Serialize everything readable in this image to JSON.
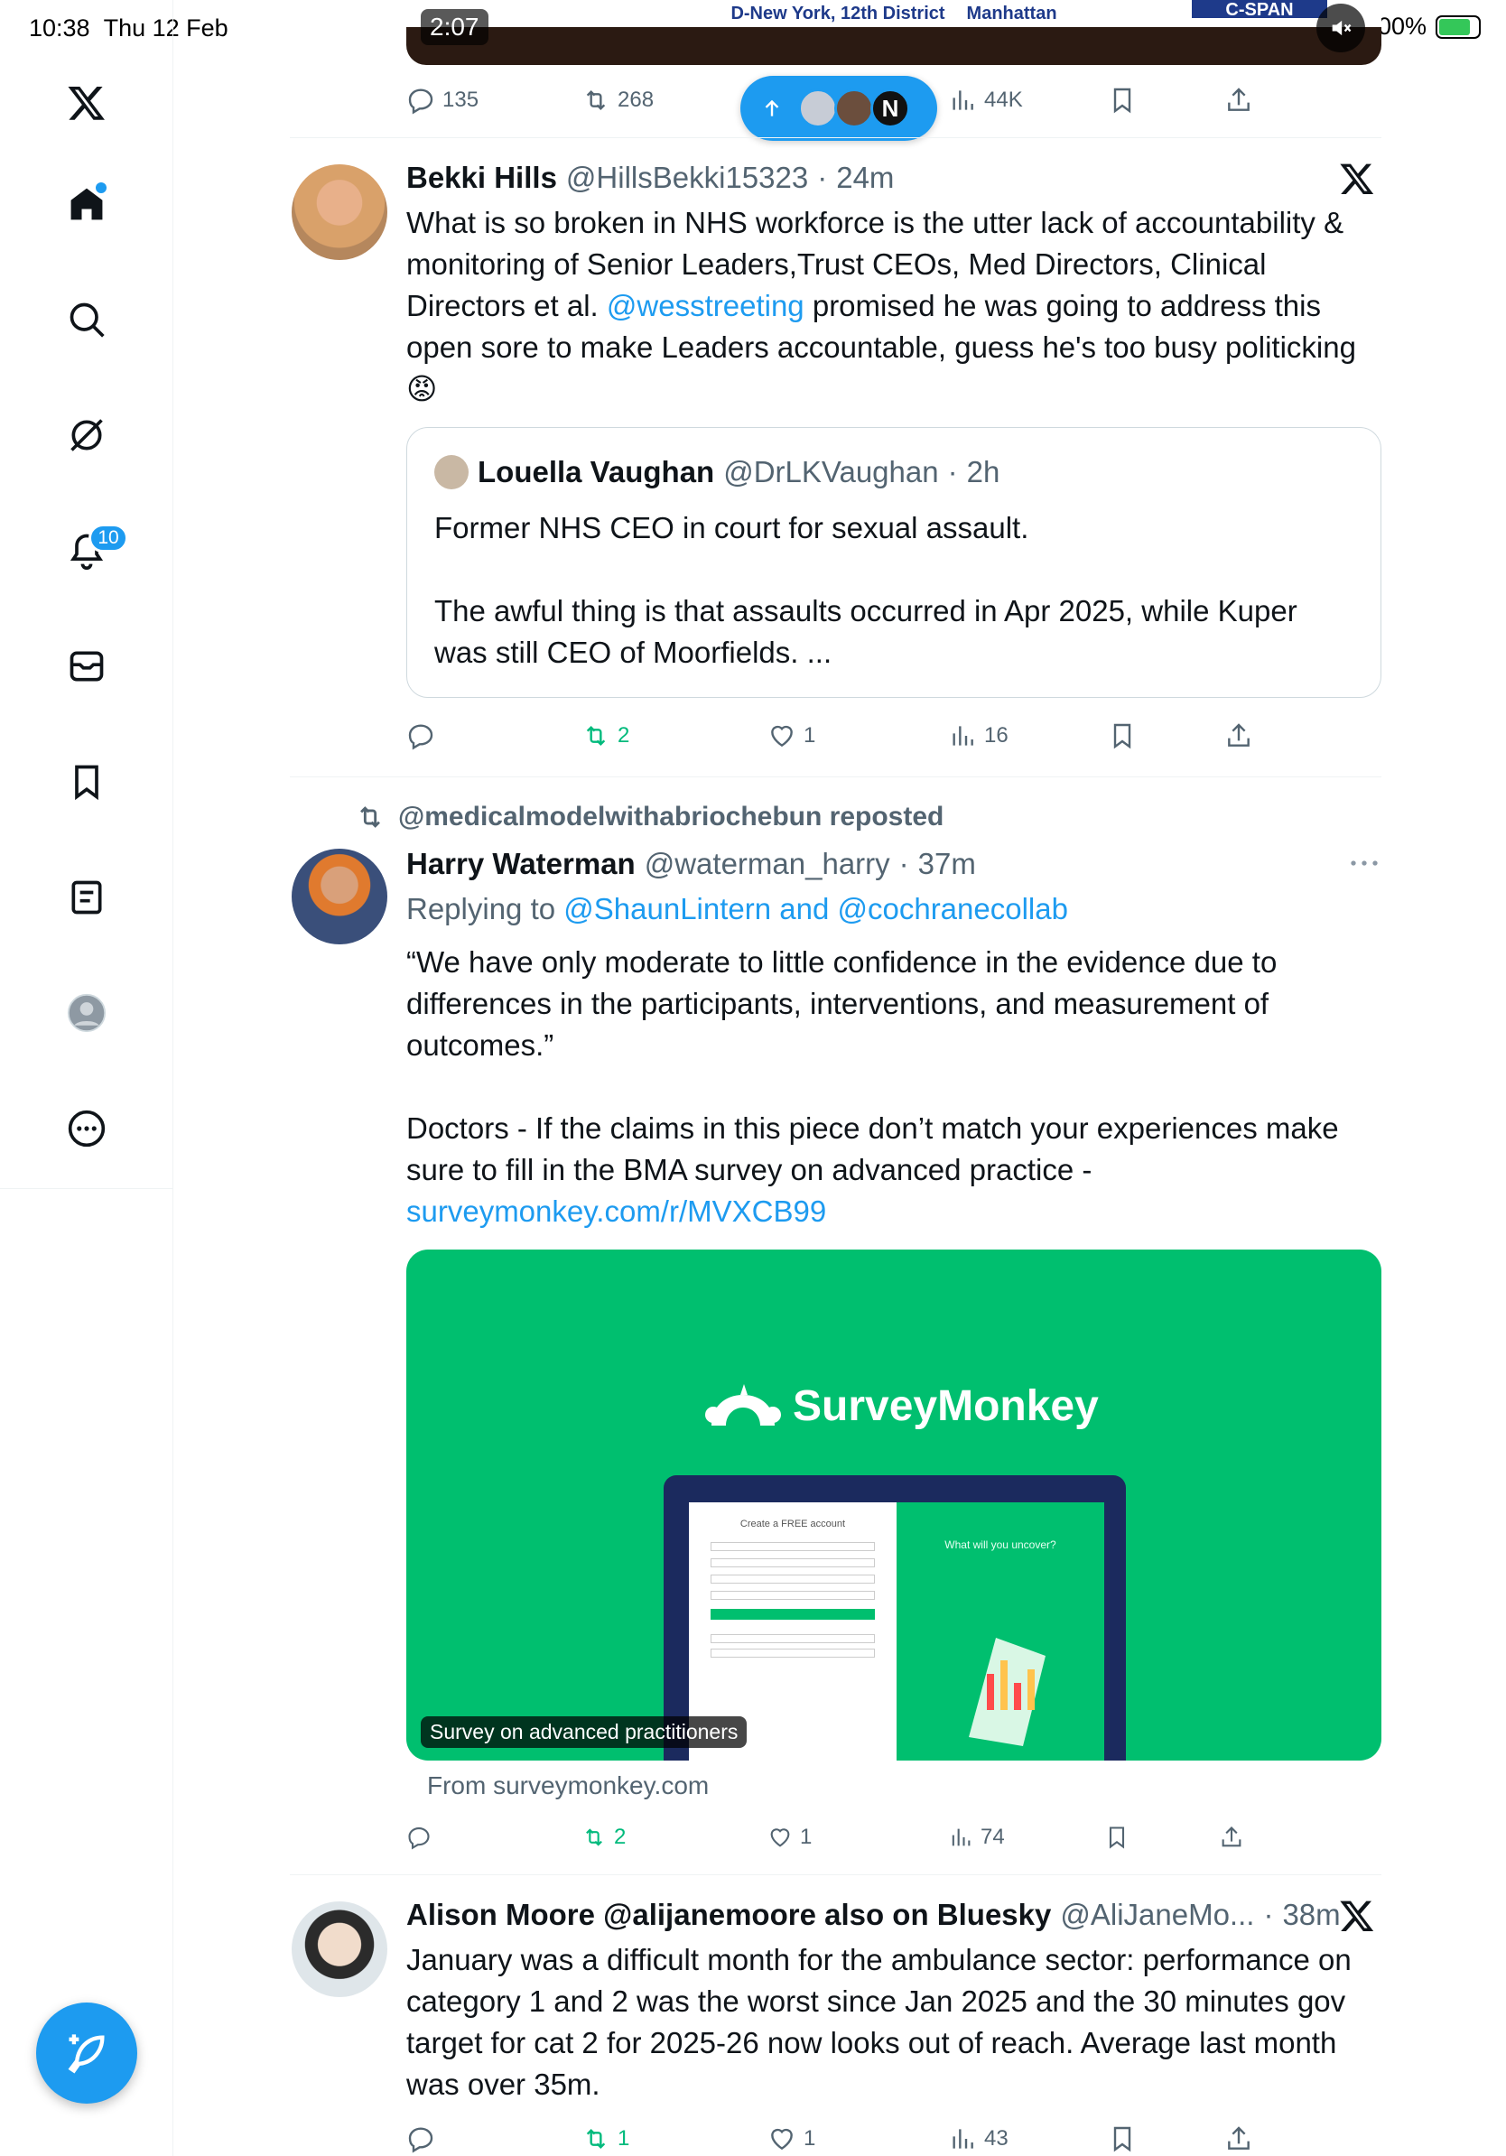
{
  "status_bar": {
    "time": "10:38",
    "date": "Thu 12 Feb",
    "battery": "100%"
  },
  "sidebar": {
    "notifications_badge": "10"
  },
  "video": {
    "time": "2:07",
    "lower_third": [
      "D-New York, 12th District",
      "Manhattan"
    ],
    "network": "C-SPAN"
  },
  "top_actions": {
    "replies": "135",
    "reposts": "268",
    "views": "44K"
  },
  "posts": [
    {
      "name": "Bekki Hills",
      "handle": "@HillsBekki15323",
      "time": "24m",
      "text_1": "What is so broken in NHS workforce is the utter lack of accountability & monitoring of Senior Leaders,Trust CEOs, Med Directors, Clinical Directors et al. ",
      "mention": "@wesstreeting",
      "text_2": " promised he was going to address this open sore to make Leaders accountable, guess he's too busy politicking",
      "emoji": "😡",
      "quote": {
        "name": "Louella Vaughan",
        "handle": "@DrLKVaughan",
        "time": "2h",
        "text": "Former NHS CEO in court for sexual assault.\n\nThe awful thing is that assaults occurred in Apr 2025, while Kuper was still CEO of Moorfields. ..."
      },
      "reposts": "2",
      "likes": "1",
      "views": "16"
    },
    {
      "repost_context": "@medicalmodelwithabriochebun reposted",
      "name": "Harry Waterman",
      "handle": "@waterman_harry",
      "time": "37m",
      "reply_prefix": "Replying to ",
      "reply_to": "@ShaunLintern and @cochranecollab",
      "text": "“We have only moderate to little confidence in the evidence due to differences in the participants, interventions, and measurement of outcomes.”\n\nDoctors - If the claims in this piece don’t match your experiences make sure to fill in the BMA survey on advanced practice -",
      "link": "surveymonkey.com/r/MVXCB99",
      "card": {
        "brand": "SurveyMonkey",
        "screen_title": "Create a FREE account",
        "screen_tagline": "What will you uncover?",
        "caption": "Survey on advanced practitioners",
        "source": "From surveymonkey.com"
      },
      "reposts": "2",
      "likes": "1",
      "views": "74"
    },
    {
      "name": "Alison Moore @alijanemoore also on Bluesky",
      "handle": "@AliJaneMo...",
      "time": "38m",
      "text": "January was a difficult month for the ambulance sector: performance on category 1 and 2 was the worst since Jan 2025 and the 30 minutes gov target for cat 2 for 2025-26 now looks out of reach. Average last month was over 35m.",
      "reposts": "1",
      "likes": "1",
      "views": "43"
    }
  ],
  "colors": {
    "accent": "#1d9bf0",
    "repost_green": "#00ba7c",
    "muted": "#536471"
  }
}
